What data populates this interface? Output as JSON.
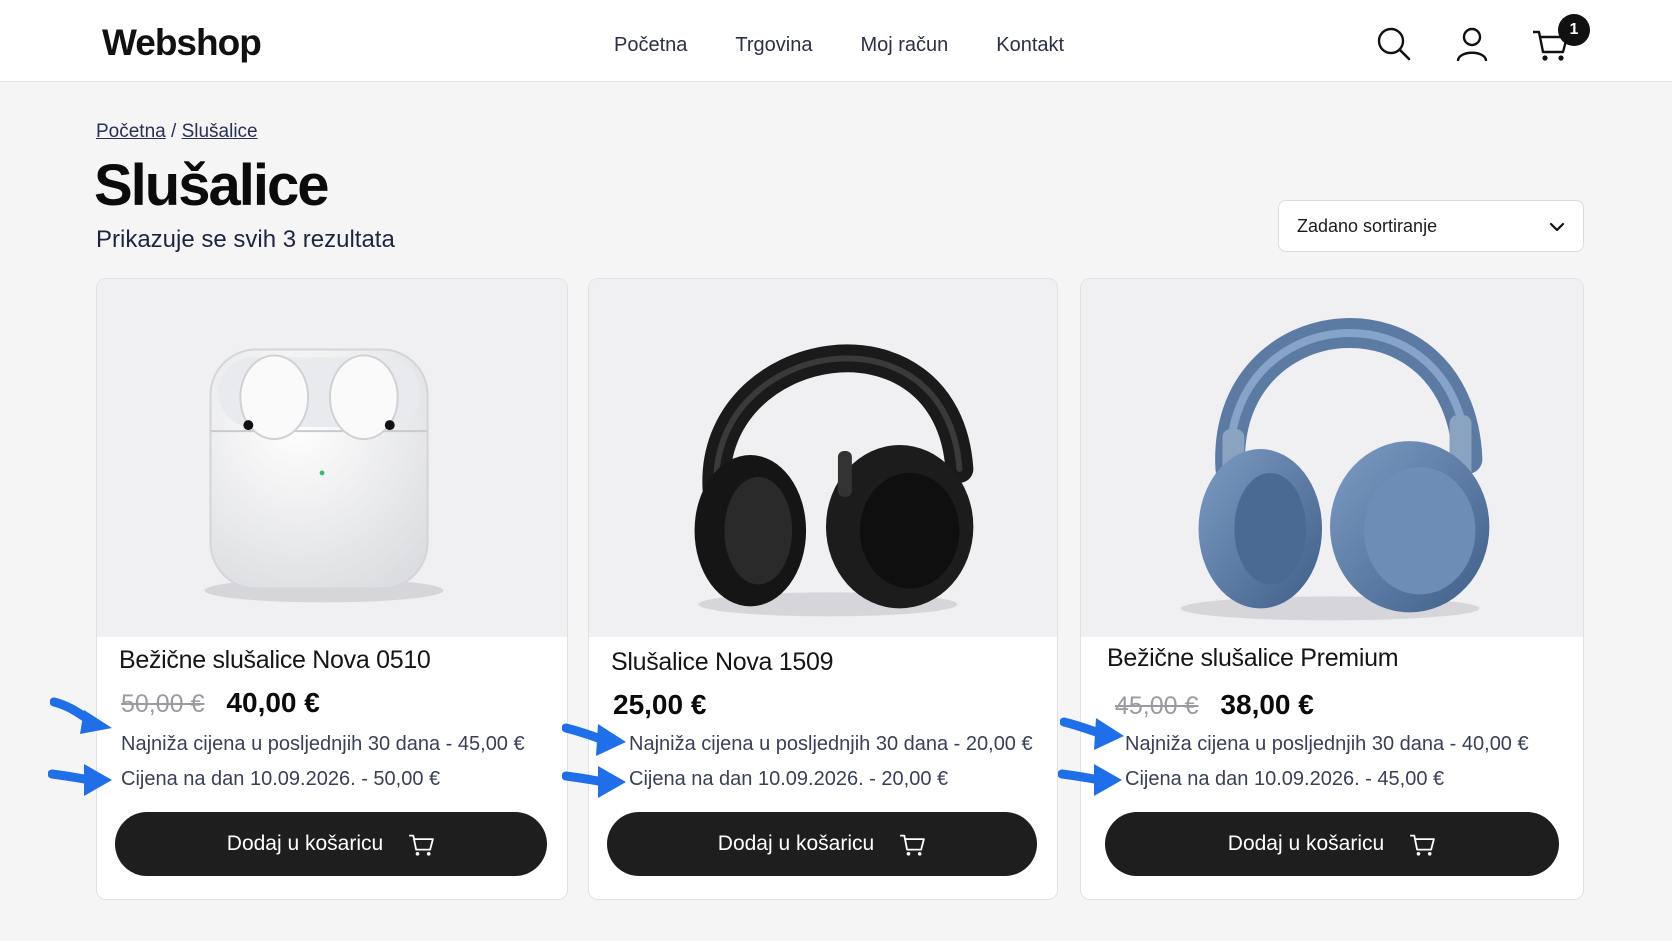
{
  "header": {
    "logo": "Webshop",
    "nav": [
      "Početna",
      "Trgovina",
      "Moj račun",
      "Kontakt"
    ],
    "cart_count": "1",
    "icons": [
      "search-icon",
      "user-icon",
      "cart-icon"
    ]
  },
  "breadcrumb": {
    "home": "Početna",
    "separator": "/",
    "current": "Slušalice"
  },
  "page": {
    "title": "Slušalice",
    "result_count": "Prikazuje se svih 3 rezultata"
  },
  "sort": {
    "selected": "Zadano sortiranje"
  },
  "products": [
    {
      "title": "Bežične slušalice Nova 0510",
      "old_price": "50,00 €",
      "price": "40,00 €",
      "lowest_price": "Najniža cijena u posljednjih 30 dana - 45,00 €",
      "price_on_date": "Cijena na dan 10.09.2026. - 50,00 €",
      "button": "Dodaj u košaricu",
      "image": "white wireless earbuds in charging case"
    },
    {
      "title": "Slušalice Nova 1509",
      "old_price": "",
      "price": "25,00 €",
      "lowest_price": "Najniža cijena u posljednjih 30 dana - 20,00 €",
      "price_on_date": "Cijena na dan 10.09.2026. - 20,00 €",
      "button": "Dodaj u košaricu",
      "image": "black over-ear headphones"
    },
    {
      "title": "Bežične slušalice Premium",
      "old_price": "45,00 €",
      "price": "38,00 €",
      "lowest_price": "Najniža cijena u posljednjih 30 dana - 40,00 €",
      "price_on_date": "Cijena na dan 10.09.2026. - 45,00 €",
      "button": "Dodaj u košaricu",
      "image": "blue over-ear headphones"
    }
  ],
  "colors": {
    "button_bg": "#1e1e1e",
    "arrow": "#1f6fe8",
    "text_muted": "#3a3f58"
  }
}
